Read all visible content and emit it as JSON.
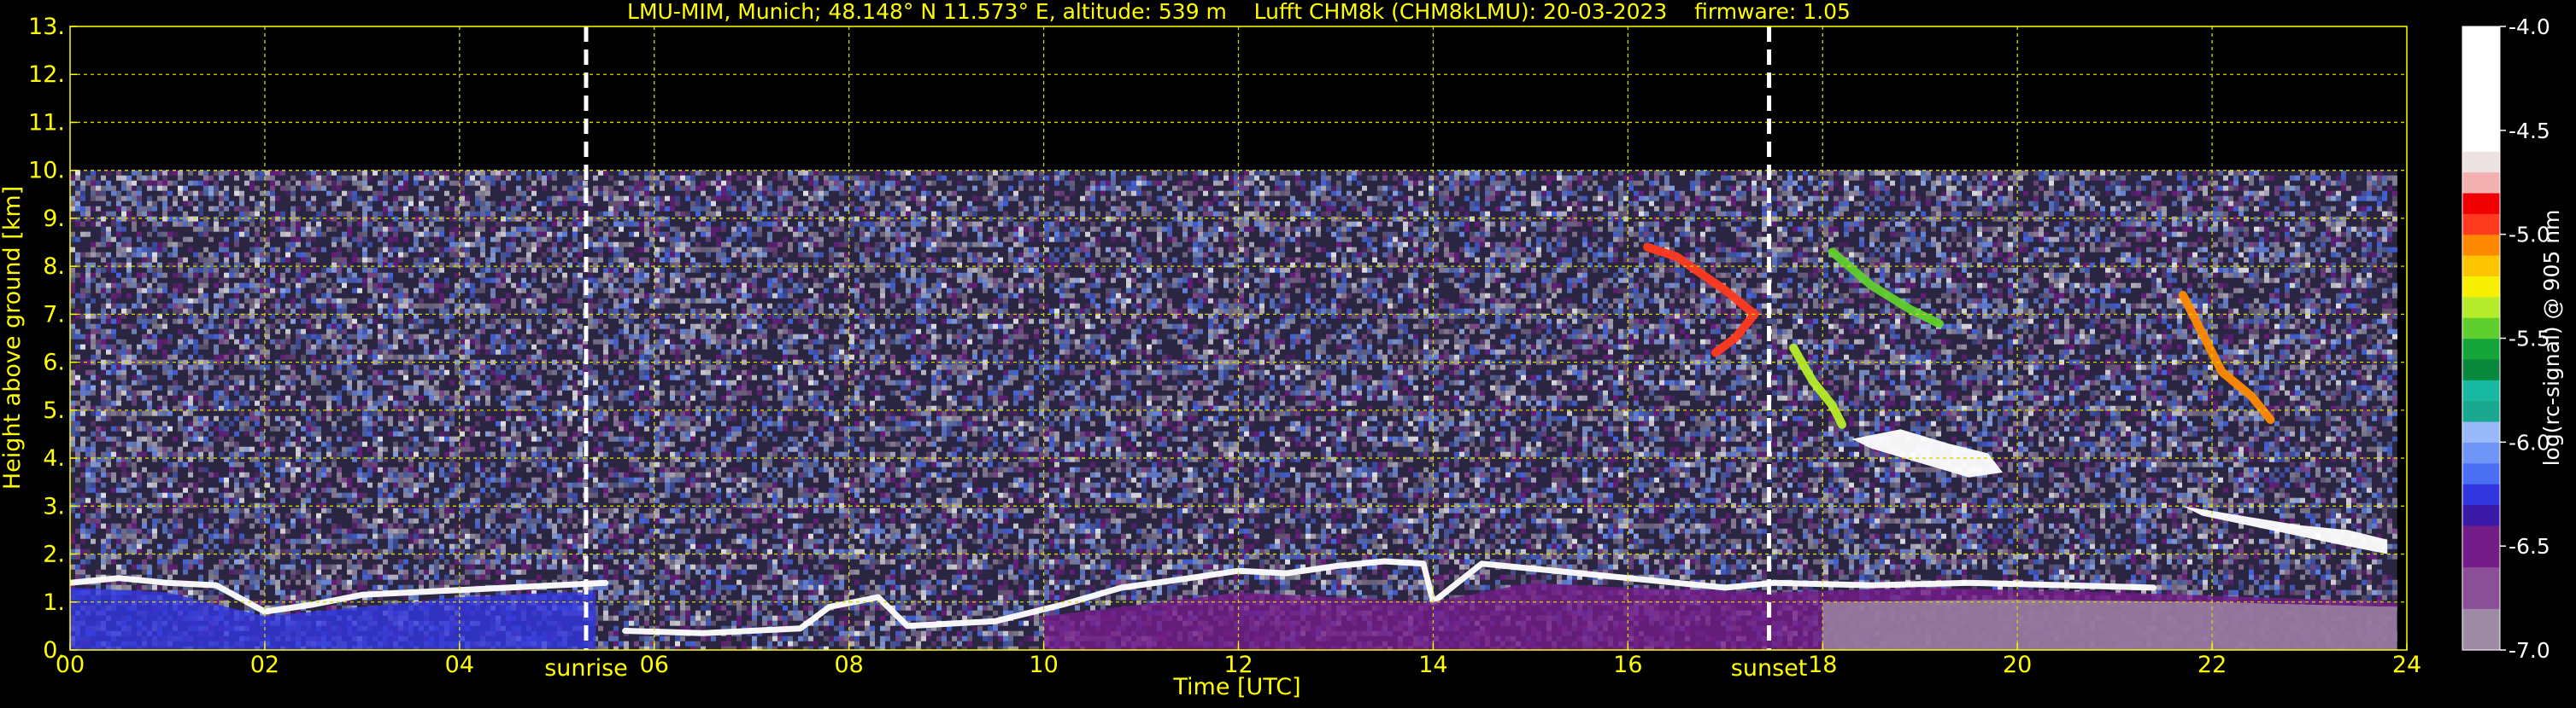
{
  "chart_data": {
    "type": "heatmap",
    "title": "LMU-MIM, Munich; 48.148° N 11.573° E, altitude: 539 m    Lufft CHM8k (CHM8kLMU): 20-03-2023    firmware: 1.05",
    "xlabel": "Time [UTC]",
    "ylabel": "Height above ground [km]",
    "xlim": [
      0,
      24
    ],
    "ylim": [
      0,
      13
    ],
    "x_ticks": [
      "00",
      "02",
      "04",
      "06",
      "08",
      "10",
      "12",
      "14",
      "16",
      "18",
      "20",
      "22",
      "24"
    ],
    "x_tick_values": [
      0,
      2,
      4,
      6,
      8,
      10,
      12,
      14,
      16,
      18,
      20,
      22,
      24
    ],
    "y_ticks": [
      "0.",
      "1.",
      "2.",
      "3.",
      "4.",
      "5.",
      "6.",
      "7.",
      "8.",
      "9.",
      "10.",
      "11.",
      "12.",
      "13."
    ],
    "y_tick_values": [
      0,
      1,
      2,
      3,
      4,
      5,
      6,
      7,
      8,
      9,
      10,
      11,
      12,
      13
    ],
    "grid": true,
    "data_extent": {
      "time": [
        0,
        23.9
      ],
      "height_km": [
        0,
        10
      ]
    },
    "events": [
      {
        "label": "sunrise",
        "time": 5.3
      },
      {
        "label": "sunset",
        "time": 17.45
      }
    ],
    "colorbar": {
      "label": "log(rc-signal) @ 905 nm",
      "range": [
        -7.0,
        -4.0
      ],
      "tick_labels": [
        "-4.0",
        "-4.5",
        "-5.0",
        "-5.5",
        "-6.0",
        "-6.5",
        "-7.0"
      ],
      "tick_values": [
        -4.0,
        -4.5,
        -5.0,
        -5.5,
        -6.0,
        -6.5,
        -7.0
      ],
      "levels": [
        {
          "from": -7.0,
          "to": -6.8,
          "color": "#9e8aa3"
        },
        {
          "from": -6.8,
          "to": -6.6,
          "color": "#8a4f96"
        },
        {
          "from": -6.6,
          "to": -6.4,
          "color": "#741c88"
        },
        {
          "from": -6.4,
          "to": -6.3,
          "color": "#3b1aa8"
        },
        {
          "from": -6.3,
          "to": -6.2,
          "color": "#3236e0"
        },
        {
          "from": -6.2,
          "to": -6.1,
          "color": "#4a6ef2"
        },
        {
          "from": -6.1,
          "to": -6.0,
          "color": "#6f95f7"
        },
        {
          "from": -6.0,
          "to": -5.9,
          "color": "#9ab9fb"
        },
        {
          "from": -5.9,
          "to": -5.8,
          "color": "#19a88e"
        },
        {
          "from": -5.8,
          "to": -5.7,
          "color": "#17b9a3"
        },
        {
          "from": -5.7,
          "to": -5.6,
          "color": "#07883a"
        },
        {
          "from": -5.6,
          "to": -5.5,
          "color": "#14a63a"
        },
        {
          "from": -5.5,
          "to": -5.4,
          "color": "#5fcf2e"
        },
        {
          "from": -5.4,
          "to": -5.3,
          "color": "#b6ec2a"
        },
        {
          "from": -5.3,
          "to": -5.2,
          "color": "#f7f100"
        },
        {
          "from": -5.2,
          "to": -5.1,
          "color": "#ffc400"
        },
        {
          "from": -5.1,
          "to": -5.0,
          "color": "#ff8a00"
        },
        {
          "from": -5.0,
          "to": -4.9,
          "color": "#ff3a1f"
        },
        {
          "from": -4.9,
          "to": -4.8,
          "color": "#f00000"
        },
        {
          "from": -4.8,
          "to": -4.7,
          "color": "#f4b0b0"
        },
        {
          "from": -4.7,
          "to": -4.6,
          "color": "#ece2e2"
        },
        {
          "from": -4.6,
          "to": -4.0,
          "color": "#ffffff"
        }
      ]
    },
    "features": [
      {
        "kind": "boundary-layer-top",
        "color": "#ffffff",
        "points": [
          [
            0.0,
            1.4
          ],
          [
            0.5,
            1.5
          ],
          [
            1.0,
            1.4
          ],
          [
            1.5,
            1.35
          ],
          [
            2.0,
            0.8
          ],
          [
            2.5,
            0.95
          ],
          [
            3.0,
            1.15
          ],
          [
            3.5,
            1.2
          ],
          [
            4.0,
            1.25
          ],
          [
            4.5,
            1.3
          ],
          [
            5.0,
            1.35
          ],
          [
            5.5,
            1.4
          ]
        ]
      },
      {
        "kind": "boundary-layer-top",
        "color": "#ffffff",
        "points": [
          [
            5.7,
            0.4
          ],
          [
            6.5,
            0.35
          ],
          [
            7.5,
            0.45
          ],
          [
            7.8,
            0.9
          ],
          [
            8.3,
            1.1
          ],
          [
            8.6,
            0.5
          ],
          [
            9.5,
            0.6
          ],
          [
            10.2,
            0.95
          ],
          [
            10.8,
            1.3
          ],
          [
            11.5,
            1.5
          ],
          [
            12.0,
            1.65
          ],
          [
            12.5,
            1.6
          ],
          [
            13.0,
            1.75
          ],
          [
            13.5,
            1.85
          ],
          [
            13.9,
            1.8
          ],
          [
            14.0,
            1.0
          ],
          [
            14.5,
            1.8
          ],
          [
            15.0,
            1.7
          ],
          [
            15.5,
            1.6
          ],
          [
            16.0,
            1.5
          ],
          [
            16.5,
            1.4
          ],
          [
            17.0,
            1.3
          ],
          [
            17.5,
            1.4
          ]
        ]
      },
      {
        "kind": "boundary-layer-top",
        "color": "#ffffff",
        "points": [
          [
            17.5,
            1.4
          ],
          [
            18.5,
            1.35
          ],
          [
            19.5,
            1.4
          ],
          [
            20.5,
            1.35
          ],
          [
            21.4,
            1.3
          ]
        ]
      },
      {
        "kind": "cloud-layer",
        "color": "#ffffff",
        "points": [
          [
            18.3,
            4.4
          ],
          [
            18.8,
            4.6
          ],
          [
            19.3,
            4.3
          ],
          [
            19.7,
            4.1
          ],
          [
            19.85,
            3.7
          ],
          [
            19.5,
            3.6
          ],
          [
            19.0,
            3.9
          ],
          [
            18.5,
            4.2
          ]
        ]
      },
      {
        "kind": "cloud-layer",
        "color": "#ffffff",
        "points": [
          [
            21.7,
            3.0
          ],
          [
            22.3,
            2.8
          ],
          [
            22.9,
            2.6
          ],
          [
            23.4,
            2.5
          ],
          [
            23.8,
            2.3
          ],
          [
            23.8,
            2.0
          ],
          [
            23.3,
            2.2
          ],
          [
            22.6,
            2.5
          ],
          [
            21.9,
            2.8
          ]
        ]
      },
      {
        "kind": "cirrus",
        "color": "#ff3a1f",
        "points": [
          [
            16.2,
            8.4
          ],
          [
            16.5,
            8.2
          ],
          [
            17.0,
            7.5
          ],
          [
            17.3,
            7.0
          ],
          [
            17.1,
            6.5
          ],
          [
            16.9,
            6.2
          ]
        ]
      },
      {
        "kind": "cirrus",
        "color": "#b6ec2a",
        "points": [
          [
            17.7,
            6.3
          ],
          [
            17.9,
            5.6
          ],
          [
            18.1,
            5.1
          ],
          [
            18.2,
            4.7
          ]
        ]
      },
      {
        "kind": "cirrus",
        "color": "#5fcf2e",
        "points": [
          [
            18.1,
            8.3
          ],
          [
            18.5,
            7.6
          ],
          [
            18.9,
            7.1
          ],
          [
            19.2,
            6.8
          ]
        ]
      },
      {
        "kind": "cirrus",
        "color": "#ff8a00",
        "points": [
          [
            21.7,
            7.4
          ],
          [
            21.9,
            6.6
          ],
          [
            22.1,
            5.8
          ],
          [
            22.4,
            5.3
          ],
          [
            22.6,
            4.8
          ]
        ]
      },
      {
        "kind": "aerosol-layer",
        "color": "#3236e0",
        "points": [
          [
            0.0,
            0.0
          ],
          [
            0.0,
            1.3
          ],
          [
            1.0,
            1.2
          ],
          [
            2.0,
            0.7
          ],
          [
            3.0,
            0.9
          ],
          [
            4.0,
            1.1
          ],
          [
            5.0,
            1.2
          ],
          [
            5.4,
            1.2
          ],
          [
            5.4,
            0.0
          ]
        ]
      },
      {
        "kind": "aerosol-layer",
        "color": "#741c88",
        "points": [
          [
            10.0,
            0.0
          ],
          [
            10.0,
            0.7
          ],
          [
            12.0,
            1.2
          ],
          [
            14.0,
            1.0
          ],
          [
            15.0,
            1.4
          ],
          [
            16.0,
            1.3
          ],
          [
            17.5,
            1.2
          ],
          [
            19.0,
            1.3
          ],
          [
            21.0,
            1.2
          ],
          [
            23.9,
            1.0
          ],
          [
            23.9,
            0.0
          ]
        ]
      },
      {
        "kind": "aerosol-layer",
        "color": "#9e8aa3",
        "points": [
          [
            18.0,
            0.0
          ],
          [
            18.0,
            1.0
          ],
          [
            20.0,
            1.05
          ],
          [
            22.0,
            1.0
          ],
          [
            23.9,
            0.9
          ],
          [
            23.9,
            0.0
          ]
        ]
      }
    ]
  }
}
